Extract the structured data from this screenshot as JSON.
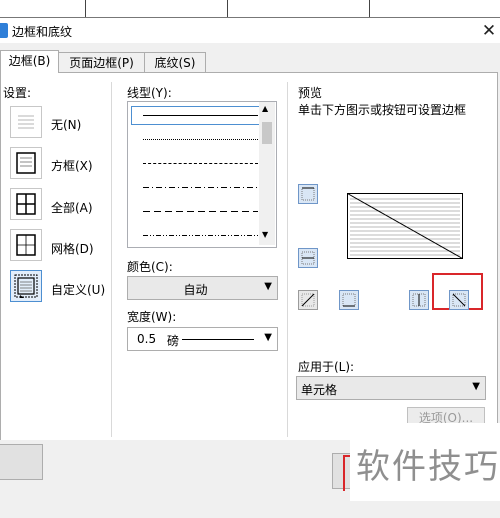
{
  "dialog": {
    "title": "边框和底纹",
    "title_icon_glyph": "",
    "close_glyph": "✕"
  },
  "tabs": [
    {
      "label": "边框(B)",
      "active": true
    },
    {
      "label": "页面边框(P)",
      "active": false
    },
    {
      "label": "底纹(S)",
      "active": false
    }
  ],
  "settings": {
    "header": "设置:",
    "items": [
      {
        "label": "无(N)",
        "icon": "setting-none-icon"
      },
      {
        "label": "方框(X)",
        "icon": "setting-box-icon"
      },
      {
        "label": "全部(A)",
        "icon": "setting-all-icon"
      },
      {
        "label": "网格(D)",
        "icon": "setting-grid-icon"
      },
      {
        "label": "自定义(U)",
        "icon": "setting-custom-icon",
        "selected": true
      }
    ]
  },
  "line_style": {
    "header": "线型(Y):",
    "options": [
      "solid",
      "dotted",
      "dashed-small",
      "dash-dot",
      "dashed-long",
      "dash-dot-dot"
    ]
  },
  "color": {
    "header": "颜色(C):",
    "value": "自动"
  },
  "width": {
    "header": "宽度(W):",
    "value": "0.5",
    "unit": "磅"
  },
  "preview": {
    "header": "预览",
    "hint": "单击下方图示或按钮可设置边框"
  },
  "apply_to": {
    "header": "应用于(L):",
    "value": "单元格"
  },
  "options_button": "选项(O)...",
  "watermark": "软件技巧",
  "colors": {
    "accent_blue": "#2f7fd8",
    "highlight_red": "#d9262a",
    "selected_bg": "#e3eefb"
  }
}
